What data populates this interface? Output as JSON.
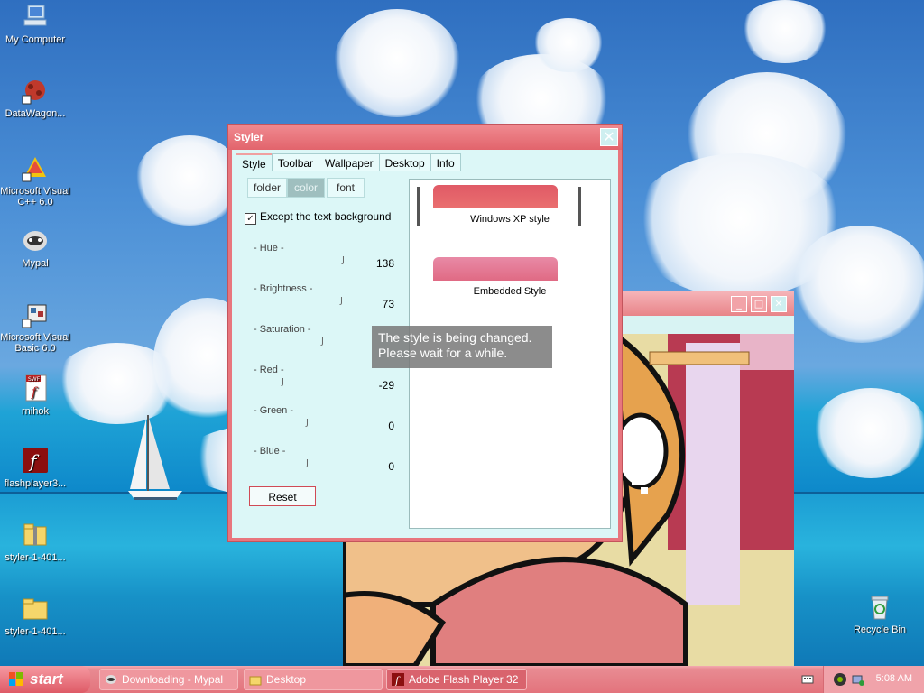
{
  "desktop": {
    "icons": [
      {
        "label": "My Computer"
      },
      {
        "label": "DataWagon..."
      },
      {
        "label": "Microsoft Visual C++ 6.0"
      },
      {
        "label": "Mypal"
      },
      {
        "label": "Microsoft Visual Basic 6.0"
      },
      {
        "label": "rnihok"
      },
      {
        "label": "flashplayer3..."
      },
      {
        "label": "styler-1-401..."
      },
      {
        "label": "styler-1-401..."
      },
      {
        "label": "Recycle Bin"
      }
    ],
    "swf_badge": "SWF"
  },
  "styler": {
    "title": "Styler",
    "tabs": [
      "Style",
      "Toolbar",
      "Wallpaper",
      "Desktop",
      "Info"
    ],
    "subtabs": [
      "folder",
      "color",
      "font"
    ],
    "checkbox_label": "Except the text background",
    "sliders": [
      {
        "label": "- Hue -",
        "value": "138"
      },
      {
        "label": "- Brightness -",
        "value": "73"
      },
      {
        "label": "- Saturation -",
        "value": ""
      },
      {
        "label": "- Red -",
        "value": "-29"
      },
      {
        "label": "- Green -",
        "value": "0"
      },
      {
        "label": "- Blue -",
        "value": "0"
      }
    ],
    "reset_label": "Reset",
    "styles": [
      {
        "name": "Windows XP style",
        "color": "#e05a66"
      },
      {
        "name": "Embedded Style",
        "color": "#e06a84"
      }
    ],
    "toast": [
      "The style is being changed.",
      "Please wait for a while."
    ]
  },
  "taskbar": {
    "start_label": "start",
    "tasks": [
      {
        "label": "Downloading - Mypal"
      },
      {
        "label": "Desktop"
      },
      {
        "label": "Adobe Flash Player 32"
      }
    ],
    "clock": "5:08 AM"
  },
  "colors": {
    "accent": "#e8767e",
    "client_bg": "#dcf7f7"
  }
}
